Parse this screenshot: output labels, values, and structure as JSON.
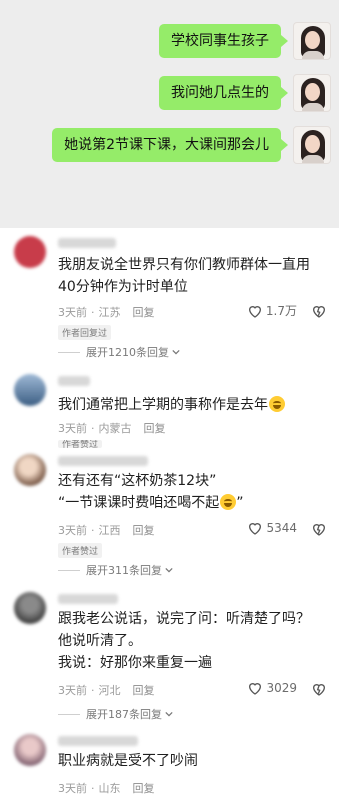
{
  "chat": {
    "messages": [
      {
        "text": "学校同事生孩子"
      },
      {
        "text": "我问她几点生的"
      },
      {
        "text": "她说第2节课下课，大课间那会儿"
      }
    ]
  },
  "comments": [
    {
      "text": "我朋友说全世界只有你们教师群体一直用40分钟作为计时单位",
      "time": "3天前",
      "location": "江苏",
      "reply_label": "回复",
      "likes": "1.7万",
      "author_tag": "作者回复过",
      "expand_label": "展开1210条回复"
    },
    {
      "text": "我们通常把上学期的事称作是去年",
      "time": "3天前",
      "location": "内蒙古",
      "reply_label": "回复",
      "author_tag": "作者赞过"
    },
    {
      "line1": "还有还有“这杯奶茶12块”",
      "line2": "“一节课课时费咱还喝不起",
      "line2_end": "”",
      "time": "3天前",
      "location": "江西",
      "reply_label": "回复",
      "likes": "5344",
      "author_tag": "作者赞过",
      "expand_label": "展开311条回复"
    },
    {
      "line1": "跟我老公说话，说完了问：听清楚了吗？",
      "line2": "他说听清了。",
      "line3": "我说：好那你来重复一遍",
      "time": "3天前",
      "location": "河北",
      "reply_label": "回复",
      "likes": "3029",
      "expand_label": "展开187条回复"
    },
    {
      "text": "职业病就是受不了吵闹",
      "time": "3天前",
      "location": "山东",
      "reply_label": "回复"
    }
  ],
  "colors": {
    "bubble": "#95ec69",
    "chat_bg": "#ededed"
  }
}
